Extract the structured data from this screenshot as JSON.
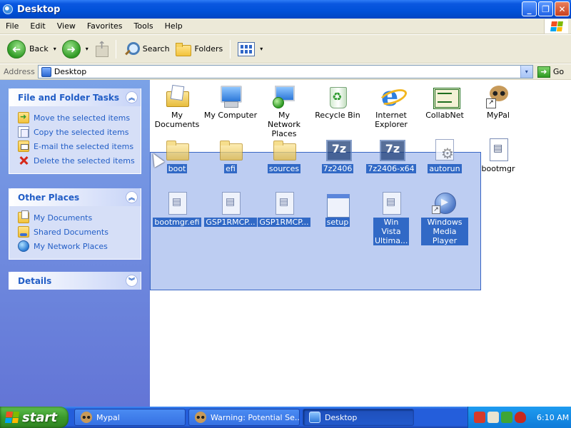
{
  "window": {
    "title": "Desktop",
    "controls": {
      "minimize": "_",
      "maximize": "❐",
      "close": "✕"
    }
  },
  "menu": [
    "File",
    "Edit",
    "View",
    "Favorites",
    "Tools",
    "Help"
  ],
  "toolbar": {
    "back": "Back",
    "forward_arrow": "➜",
    "back_arrow": "➜",
    "dropdown": "▾",
    "search": "Search",
    "folders": "Folders"
  },
  "address": {
    "label": "Address",
    "value": "Desktop",
    "go": "Go",
    "go_arrow": "➜",
    "dropdown": "▾"
  },
  "sidebar": {
    "file_tasks": {
      "title": "File and Folder Tasks",
      "chevron": "︽",
      "items": [
        {
          "label": "Move the selected items",
          "icon": "move-icon"
        },
        {
          "label": "Copy the selected items",
          "icon": "copy-icon"
        },
        {
          "label": "E-mail the selected items",
          "icon": "email-icon"
        },
        {
          "label": "Delete the selected items",
          "icon": "delete-icon"
        }
      ]
    },
    "other_places": {
      "title": "Other Places",
      "chevron": "︽",
      "items": [
        {
          "label": "My Documents",
          "icon": "my-documents-icon"
        },
        {
          "label": "Shared Documents",
          "icon": "shared-documents-icon"
        },
        {
          "label": "My Network Places",
          "icon": "network-places-icon"
        }
      ]
    },
    "details": {
      "title": "Details",
      "chevron": "︾"
    }
  },
  "desktop_items": [
    {
      "label": "My Documents",
      "icon": "my-documents-icon",
      "selected": false
    },
    {
      "label": "My Computer",
      "icon": "my-computer-icon",
      "selected": false
    },
    {
      "label": "My Network Places",
      "icon": "network-places-icon",
      "selected": false
    },
    {
      "label": "Recycle Bin",
      "icon": "recycle-bin-icon",
      "selected": false
    },
    {
      "label": "Internet Explorer",
      "icon": "internet-explorer-icon",
      "selected": false
    },
    {
      "label": "CollabNet",
      "icon": "collabnet-icon",
      "selected": false
    },
    {
      "label": "MyPal",
      "icon": "mypal-icon",
      "selected": false,
      "shortcut": true
    },
    {
      "label": "boot",
      "icon": "folder-icon",
      "selected": true
    },
    {
      "label": "efi",
      "icon": "folder-icon",
      "selected": true
    },
    {
      "label": "sources",
      "icon": "folder-icon",
      "selected": true
    },
    {
      "label": "7z2406",
      "icon": "7zip-icon",
      "selected": true
    },
    {
      "label": "7z2406-x64",
      "icon": "7zip-icon",
      "selected": true
    },
    {
      "label": "autorun",
      "icon": "autorun-icon",
      "selected": true
    },
    {
      "label": "bootmgr",
      "icon": "system-file-icon",
      "selected": false
    },
    {
      "label": "bootmgr.efi",
      "icon": "system-file-icon",
      "selected": true
    },
    {
      "label": "GSP1RMCP...",
      "icon": "system-file-icon",
      "selected": true
    },
    {
      "label": "GSP1RMCP...",
      "icon": "system-file-icon",
      "selected": true
    },
    {
      "label": "setup",
      "icon": "setup-window-icon",
      "selected": true
    },
    {
      "label": "Win Vista Ultima...",
      "icon": "system-file-icon",
      "selected": true
    },
    {
      "label": "Windows Media Player",
      "icon": "media-player-icon",
      "selected": true,
      "shortcut": true
    }
  ],
  "shortcut_glyph": "↗",
  "taskbar": {
    "start": "start",
    "buttons": [
      {
        "label": "Mypal",
        "icon": "mypal-icon",
        "active": false
      },
      {
        "label": "Warning: Potential Se...",
        "icon": "mypal-icon",
        "active": false
      },
      {
        "label": "Desktop",
        "icon": "desktop-window-icon",
        "active": true
      }
    ],
    "clock": "6:10 AM"
  },
  "colors": {
    "title_blue": "#0051d8",
    "sidebar_link": "#215dc6",
    "selection_blue": "#3169c6",
    "start_green": "#3b9a2c",
    "tray_blue": "#0f7ad8"
  }
}
